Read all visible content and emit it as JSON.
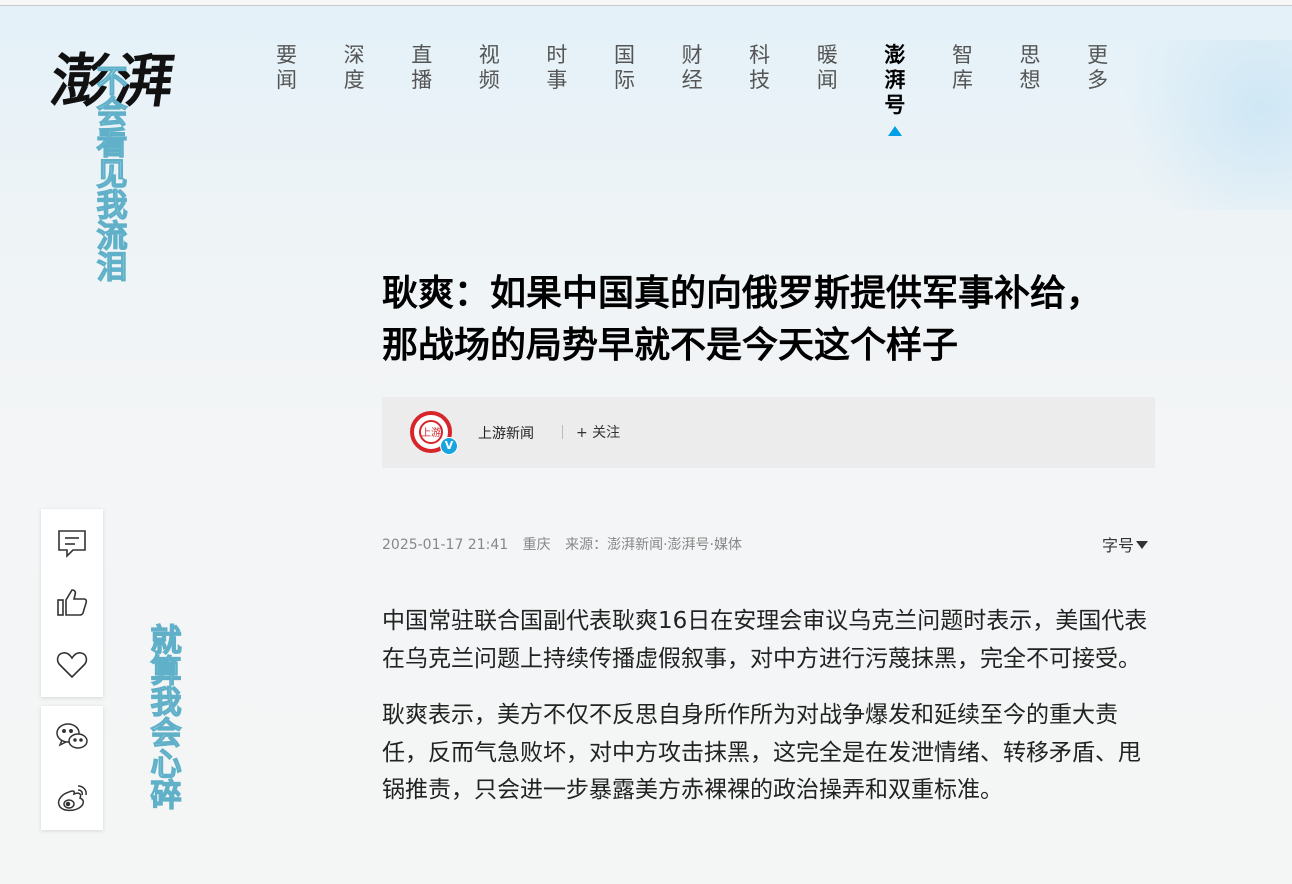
{
  "site": {
    "logo_text": "澎湃"
  },
  "nav": {
    "items": [
      {
        "line1": "要",
        "line2": "闻"
      },
      {
        "line1": "深",
        "line2": "度"
      },
      {
        "line1": "直",
        "line2": "播"
      },
      {
        "line1": "视",
        "line2": "频"
      },
      {
        "line1": "时",
        "line2": "事"
      },
      {
        "line1": "国",
        "line2": "际"
      },
      {
        "line1": "财",
        "line2": "经"
      },
      {
        "line1": "科",
        "line2": "技"
      },
      {
        "line1": "暖",
        "line2": "闻"
      },
      {
        "line1": "澎",
        "line2": "湃",
        "line3": "号",
        "active": true
      },
      {
        "line1": "智",
        "line2": "库"
      },
      {
        "line1": "思",
        "line2": "想"
      },
      {
        "line1": "更",
        "line2": "多"
      }
    ]
  },
  "decorations": {
    "vertical_text_1": "不会看见我流泪",
    "vertical_text_2": "就算我会心碎"
  },
  "article": {
    "title": "耿爽：如果中国真的向俄罗斯提供军事补给，那战场的局势早就不是今天这个样子",
    "author": {
      "name": "上游新闻",
      "avatar_text": "上游",
      "verified_badge": "V",
      "follow_label": "+ 关注"
    },
    "meta": {
      "datetime": "2025-01-17 21:41",
      "location": "重庆",
      "source": "来源：澎湃新闻·澎湃号·媒体"
    },
    "font_size_label": "字号",
    "paragraphs": [
      "中国常驻联合国副代表耿爽16日在安理会审议乌克兰问题时表示，美国代表在乌克兰问题上持续传播虚假叙事，对中方进行污蔑抹黑，完全不可接受。",
      "耿爽表示，美方不仅不反思自身所作所为对战争爆发和延续至今的重大责任，反而气急败坏，对中方攻击抹黑，这完全是在发泄情绪、转移矛盾、甩锅推责，只会进一步暴露美方赤裸裸的政治操弄和双重标准。"
    ]
  },
  "sidebar": {
    "icons": [
      "comment-icon",
      "like-icon",
      "heart-icon",
      "wechat-icon",
      "weibo-icon"
    ]
  },
  "colors": {
    "accent": "#00a0e9",
    "avatar_red": "#d6262c",
    "deco_stroke": "#5fb0c8"
  }
}
